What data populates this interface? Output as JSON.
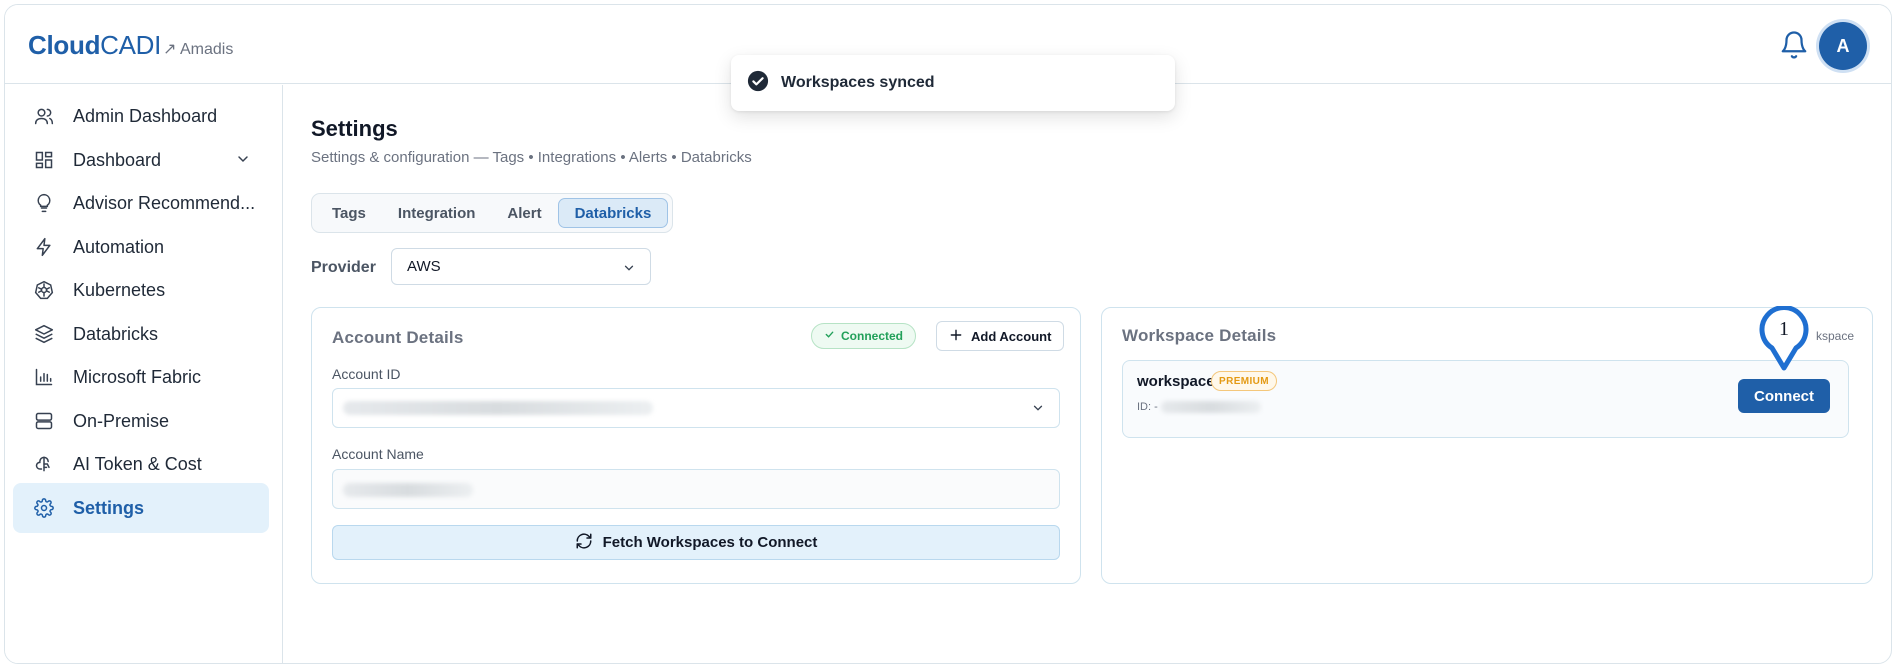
{
  "header": {
    "logo_bold": "Cloud",
    "logo_light": "CADI",
    "tenant": "↗ Amadis",
    "avatar_initial": "A",
    "icons": {
      "bell": "bell-icon"
    }
  },
  "toast": {
    "message": "Workspaces synced",
    "icon": "check-circle-icon"
  },
  "sidebar": {
    "items": [
      {
        "label": "Admin Dashboard",
        "icon": "users-icon"
      },
      {
        "label": "Dashboard",
        "icon": "dashboard-grid-icon",
        "has_chevron": true
      },
      {
        "label": "Advisor Recommend...",
        "icon": "lightbulb-icon"
      },
      {
        "label": "Automation",
        "icon": "lightning-icon"
      },
      {
        "label": "Kubernetes",
        "icon": "kubernetes-icon"
      },
      {
        "label": "Databricks",
        "icon": "layers-icon"
      },
      {
        "label": "Microsoft Fabric",
        "icon": "bar-chart-icon"
      },
      {
        "label": "On-Premise",
        "icon": "server-icon"
      },
      {
        "label": "AI Token & Cost",
        "icon": "brain-icon"
      },
      {
        "label": "Settings",
        "icon": "gear-icon",
        "active": true
      }
    ]
  },
  "main": {
    "title": "Settings",
    "subtitle": "Settings & configuration — Tags • Integrations • Alerts • Databricks",
    "tabs": [
      {
        "label": "Tags"
      },
      {
        "label": "Integration"
      },
      {
        "label": "Alert"
      },
      {
        "label": "Databricks",
        "active": true
      }
    ],
    "provider": {
      "label": "Provider",
      "value": "AWS"
    }
  },
  "account_details": {
    "title": "Account Details",
    "status": "Connected",
    "add_account": "Add Account",
    "account_id_label": "Account ID",
    "account_name_label": "Account Name",
    "fetch_button": "Fetch Workspaces to Connect"
  },
  "workspace_details": {
    "title": "Workspace Details",
    "corner_text": "kspace",
    "workspace": {
      "name": "workspace",
      "tier": "PREMIUM",
      "id_label": "ID: -"
    },
    "connect_button": "Connect",
    "marker_label": "1"
  },
  "colors": {
    "brand": "#1f5fa8",
    "success": "#22a05a",
    "premium": "#e49a14",
    "active_bg": "#e3f1fb"
  }
}
